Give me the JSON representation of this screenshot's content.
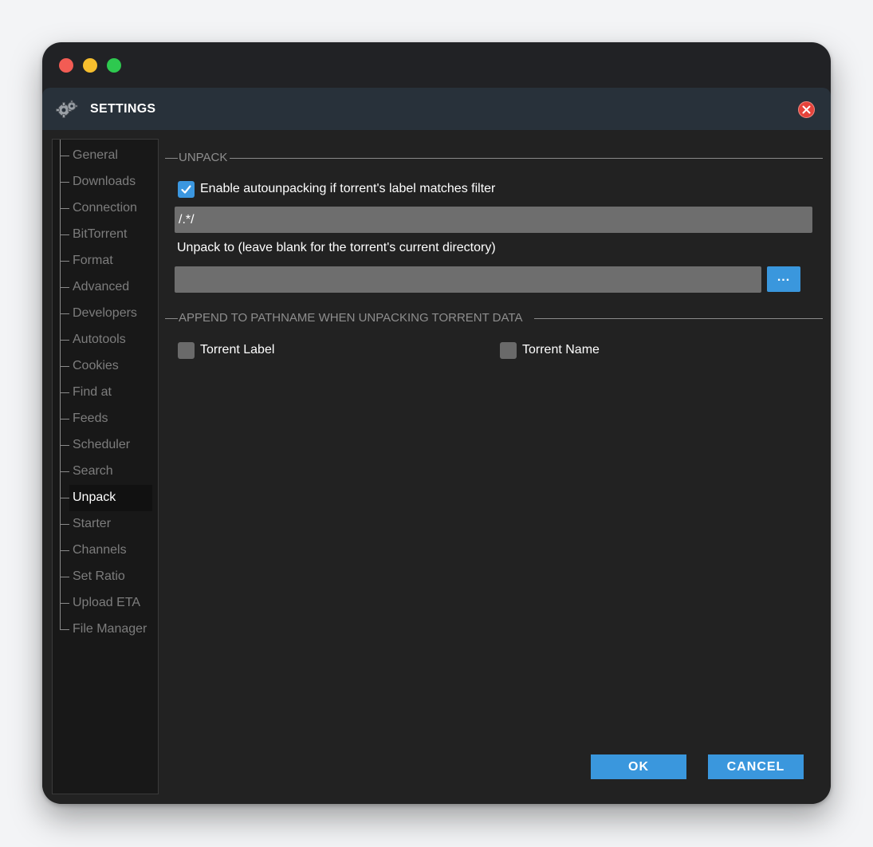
{
  "dialog": {
    "title": "SETTINGS",
    "icon": "gears-icon"
  },
  "sidebar": {
    "items": [
      {
        "label": "General",
        "active": false
      },
      {
        "label": "Downloads",
        "active": false
      },
      {
        "label": "Connection",
        "active": false
      },
      {
        "label": "BitTorrent",
        "active": false
      },
      {
        "label": "Format",
        "active": false
      },
      {
        "label": "Advanced",
        "active": false
      },
      {
        "label": "Developers",
        "active": false
      },
      {
        "label": "Autotools",
        "active": false
      },
      {
        "label": "Cookies",
        "active": false
      },
      {
        "label": "Find at",
        "active": false
      },
      {
        "label": "Feeds",
        "active": false
      },
      {
        "label": "Scheduler",
        "active": false
      },
      {
        "label": "Search",
        "active": false
      },
      {
        "label": "Unpack",
        "active": true
      },
      {
        "label": "Starter",
        "active": false
      },
      {
        "label": "Channels",
        "active": false
      },
      {
        "label": "Set Ratio",
        "active": false
      },
      {
        "label": "Upload ETA",
        "active": false
      },
      {
        "label": "File Manager",
        "active": false
      }
    ]
  },
  "unpack": {
    "section_title": "UNPACK",
    "enable_label": "Enable autounpacking if torrent's label matches filter",
    "enable_checked": true,
    "filter_value": "/.*/",
    "unpack_to_label": "Unpack to (leave blank for the torrent's current directory)",
    "unpack_to_value": "",
    "browse_label": "..."
  },
  "append": {
    "section_title": "APPEND TO PATHNAME WHEN UNPACKING TORRENT DATA",
    "torrent_label": "Torrent Label",
    "torrent_label_checked": false,
    "torrent_name": "Torrent Name",
    "torrent_name_checked": false
  },
  "buttons": {
    "ok": "OK",
    "cancel": "CANCEL"
  },
  "colors": {
    "accent": "#3a97dd",
    "close": "#e5433b",
    "titlebar": "#28313a"
  }
}
